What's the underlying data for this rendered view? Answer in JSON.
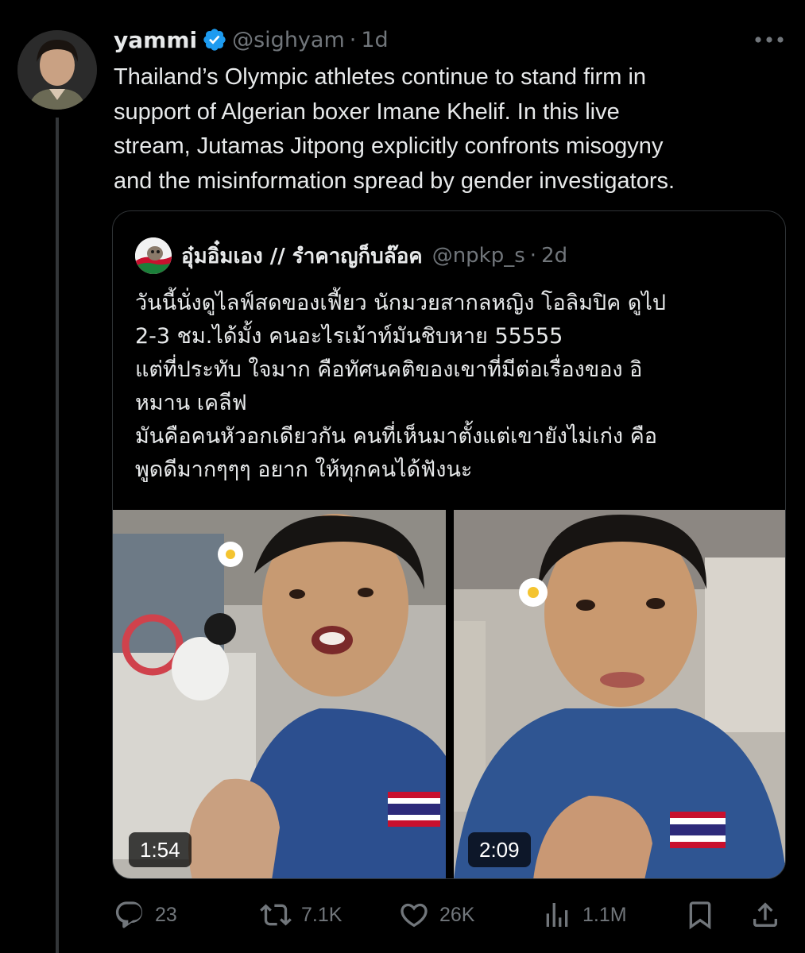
{
  "author": {
    "display_name": "yammi",
    "handle": "@sighyam",
    "separator": "·",
    "time": "1d",
    "verified": true
  },
  "tweet_text": "Thailand’s Olympic athletes continue to stand firm in\nsupport of Algerian boxer Imane Khelif. In this live\nstream, Jutamas Jitpong explicitly confronts misogyny\nand the misinformation spread by gender investigators.",
  "quote": {
    "display_name": "อุ๋มอิ๋มเอง // รำคาญก็บล๊อค",
    "handle": "@npkp_s",
    "separator": "·",
    "time": "2d",
    "text": "วันนี้นั่งดูไลฟ์สดของเฟี้ยว นักมวยสากลหญิง โอลิมปิค ดูไป\n2-3 ชม.ได้มั้ง คนอะไรเม้าท์มันชิบหาย 55555\nแต่ที่ประทับ ใจมาก คือทัศนคติของเขาที่มีต่อเรื่องของ อิ\nหมาน เคลีฟ\nมันคือคนหัวอกเดียวกัน คนที่เห็นมาตั้งแต่เขายังไม่เก่ง คือ\nพูดดีมากๆๆๆ อยาก ให้ทุกคนได้ฟังนะ",
    "media": [
      {
        "duration": "1:54"
      },
      {
        "duration": "2:09"
      }
    ]
  },
  "actions": {
    "reply_count": "23",
    "retweet_count": "7.1K",
    "like_count": "26K",
    "views_count": "1.1M"
  },
  "colors": {
    "background": "#000000",
    "text_primary": "#e7e9ea",
    "text_secondary": "#71767b",
    "border": "#2f3336",
    "verified": "#1d9bf0"
  }
}
